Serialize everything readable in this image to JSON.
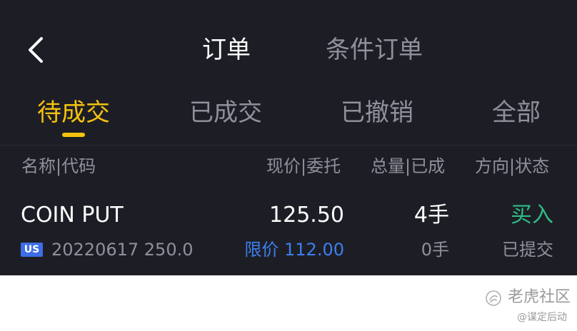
{
  "header": {
    "tabs": [
      {
        "label": "订单",
        "active": true
      },
      {
        "label": "条件订单",
        "active": false
      }
    ]
  },
  "filters": [
    {
      "label": "待成交",
      "active": true
    },
    {
      "label": "已成交",
      "active": false
    },
    {
      "label": "已撤销",
      "active": false
    },
    {
      "label": "全部",
      "active": false
    }
  ],
  "columns": {
    "name_code": "名称|代码",
    "price": "现价|委托",
    "qty": "总量|已成",
    "dir_status": "方向|状态"
  },
  "orders": [
    {
      "name": "COIN PUT",
      "market": "US",
      "code": "20220617 250.0",
      "current_price": "125.50",
      "order_type": "限价",
      "order_price": "112.00",
      "total_qty": "4手",
      "filled_qty": "0手",
      "direction": "买入",
      "status": "已提交"
    }
  ],
  "watermark": {
    "brand": "老虎社区",
    "author": "@谋定后动"
  },
  "colors": {
    "background": "#1d1e25",
    "accent": "#f4c20d",
    "buy": "#2ebd85",
    "limit_blue": "#3d7ef0",
    "muted": "#8e909b"
  }
}
